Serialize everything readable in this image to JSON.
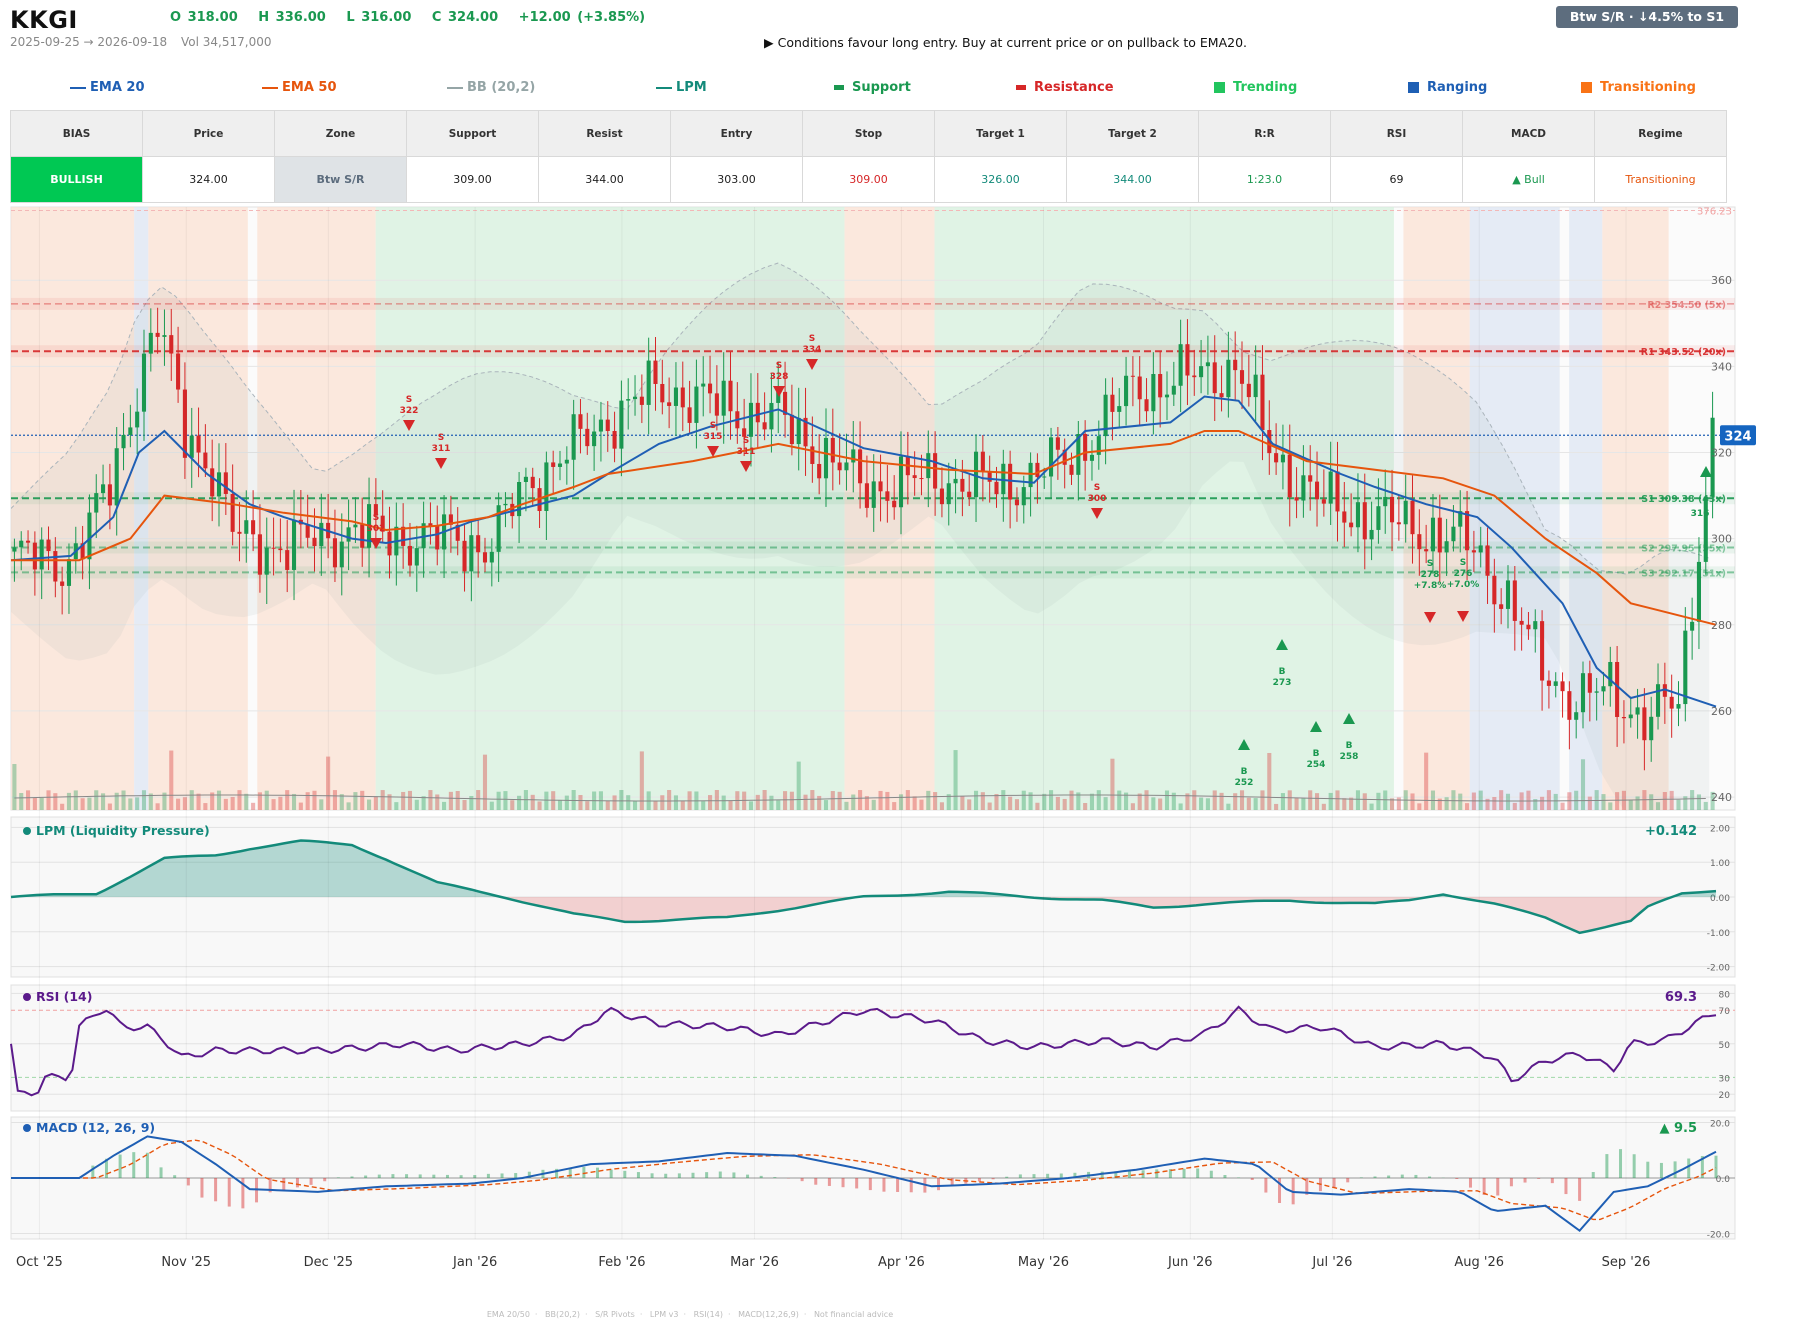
{
  "header": {
    "ticker": "KKGI",
    "ohlc": {
      "open": "O 318.00",
      "high": "H 336.00",
      "low": "L 316.00",
      "close": "C 324.00",
      "change": "+12.00 (+3.85%)"
    },
    "date_range": "2025-09-25 → 2026-09-18",
    "volume": "Vol 34,517,000",
    "advice": "▶  Conditions favour long entry. Buy at current price or on pullback to EMA20.",
    "zone_badge": "Btw S/R  ·  ↓4.5% to S1"
  },
  "legend": {
    "ema20": "EMA 20",
    "ema50": "EMA 50",
    "bb": "BB (20,2)",
    "lpm": "LPM",
    "support": "Support",
    "resistance": "Resistance",
    "trending": "Trending",
    "ranging": "Ranging",
    "transitioning": "Transitioning"
  },
  "colors": {
    "bull": "#1a9850",
    "bear": "#d62728",
    "ema20": "#1f5fb4",
    "ema50": "#e6550d",
    "bb": "#95a5a6",
    "lpm": "#138a7a",
    "support": "#1a9850",
    "resistance": "#d62728",
    "rsi": "#5b1a8b",
    "macd": "#1f5fb4",
    "trending": "#22c55e",
    "ranging": "#1e5fb4",
    "transitioning": "#f97316",
    "bullish_badge": "#00c853"
  },
  "summary": {
    "headers": [
      "BIAS",
      "Price",
      "Zone",
      "Support",
      "Resist",
      "Entry",
      "Stop",
      "Target 1",
      "Target 2",
      "R:R",
      "RSI",
      "MACD",
      "Regime"
    ],
    "values": [
      "BULLISH",
      "324.00",
      "Btw S/R",
      "309.00",
      "344.00",
      "303.00",
      "309.00",
      "326.00",
      "344.00",
      "1:23.0",
      "69",
      "▲ Bull",
      "Transitioning"
    ]
  },
  "price_axis": {
    "ticks": [
      "240",
      "260",
      "280",
      "300",
      "320",
      "340",
      "360"
    ],
    "top_label": "376.23",
    "last_price": "324"
  },
  "levels": {
    "r2": "R2 354.50 (5x)",
    "r1": "R1 343.52 (20x)",
    "s1": "S1 309.38 (43x)",
    "s2": "S2 297.95 (55x)",
    "s3": "S3 292.17 (51x)",
    "last_s_label": "316"
  },
  "months": [
    "Oct '25",
    "Nov '25",
    "Dec '25",
    "Jan '26",
    "Feb '26",
    "Mar '26",
    "Apr '26",
    "May '26",
    "Jun '26",
    "Jul '26",
    "Aug '26",
    "Sep '26"
  ],
  "signals": {
    "sell": [
      {
        "label": "S",
        "value": "302"
      },
      {
        "label": "S",
        "value": "322"
      },
      {
        "label": "S",
        "value": "311"
      },
      {
        "label": "S",
        "value": "315"
      },
      {
        "label": "S",
        "value": "311"
      },
      {
        "label": "S",
        "value": "328"
      },
      {
        "label": "S",
        "value": "334"
      },
      {
        "label": "S",
        "value": "300"
      },
      {
        "label": "S",
        "value": "278",
        "pct": "+7.8%"
      },
      {
        "label": "S",
        "value": "276",
        "pct": "+7.0%"
      }
    ],
    "buy": [
      {
        "label": "B",
        "value": "252"
      },
      {
        "label": "B",
        "value": "273"
      },
      {
        "label": "B",
        "value": "254"
      },
      {
        "label": "B",
        "value": "258"
      }
    ]
  },
  "panels": {
    "lpm": {
      "title": "LPM (Liquidity Pressure)",
      "value": "+0.142",
      "ticks": [
        "2.00",
        "1.00",
        "0.00",
        "-1.00",
        "-2.00"
      ]
    },
    "rsi": {
      "title": "RSI (14)",
      "value": "69.3",
      "ticks": [
        "80",
        "70",
        "50",
        "30",
        "20"
      ]
    },
    "macd": {
      "title": "MACD (12, 26, 9)",
      "value": "▲ 9.5",
      "ticks": [
        "20.0",
        "0.0",
        "-20.0"
      ]
    }
  },
  "footer": [
    "EMA 20/50",
    "BB(20,2)",
    "S/R Pivots",
    "LPM v3",
    "RSI(14)",
    "MACD(12,26,9)",
    "Not financial advice"
  ],
  "chart_data": {
    "type": "candlestick",
    "ylim": [
      237,
      377
    ],
    "regimes": [
      {
        "type": "transitioning",
        "start": "2025-09-25",
        "end": "2025-10-21"
      },
      {
        "type": "ranging",
        "start": "2025-10-21",
        "end": "2025-10-24"
      },
      {
        "type": "transitioning",
        "start": "2025-10-24",
        "end": "2025-11-14"
      },
      {
        "type": "transitioning",
        "start": "2025-11-16",
        "end": "2025-12-11"
      },
      {
        "type": "trending",
        "start": "2025-12-11",
        "end": "2026-03-20"
      },
      {
        "type": "transitioning",
        "start": "2026-03-20",
        "end": "2026-04-08"
      },
      {
        "type": "trending",
        "start": "2026-04-08",
        "end": "2026-07-14"
      },
      {
        "type": "transitioning",
        "start": "2026-07-16",
        "end": "2026-07-30"
      },
      {
        "type": "ranging",
        "start": "2026-07-30",
        "end": "2026-08-18"
      },
      {
        "type": "ranging",
        "start": "2026-08-20",
        "end": "2026-08-27"
      },
      {
        "type": "transitioning",
        "start": "2026-08-27",
        "end": "2026-09-10"
      }
    ],
    "levels": [
      {
        "name": "R2",
        "value": 354.5,
        "touches": 5,
        "kind": "resistance"
      },
      {
        "name": "R1",
        "value": 343.52,
        "touches": 20,
        "kind": "resistance"
      },
      {
        "name": "S1",
        "value": 309.38,
        "touches": 43,
        "kind": "support"
      },
      {
        "name": "S2",
        "value": 297.95,
        "touches": 55,
        "kind": "support"
      },
      {
        "name": "S3",
        "value": 292.17,
        "touches": 51,
        "kind": "support"
      }
    ],
    "last_close": 324,
    "series": [
      {
        "name": "EMA 20",
        "points": [
          [
            0,
            295
          ],
          [
            0.035,
            296
          ],
          [
            0.06,
            305
          ],
          [
            0.075,
            320
          ],
          [
            0.09,
            325
          ],
          [
            0.115,
            315
          ],
          [
            0.14,
            308
          ],
          [
            0.16,
            305
          ],
          [
            0.2,
            300
          ],
          [
            0.22,
            299
          ],
          [
            0.25,
            301
          ],
          [
            0.27,
            304
          ],
          [
            0.3,
            307
          ],
          [
            0.33,
            310
          ],
          [
            0.35,
            315
          ],
          [
            0.38,
            322
          ],
          [
            0.41,
            326
          ],
          [
            0.45,
            330
          ],
          [
            0.5,
            321
          ],
          [
            0.54,
            318
          ],
          [
            0.57,
            314
          ],
          [
            0.6,
            313
          ],
          [
            0.63,
            325
          ],
          [
            0.68,
            327
          ],
          [
            0.7,
            333
          ],
          [
            0.72,
            332
          ],
          [
            0.74,
            322
          ],
          [
            0.78,
            315
          ],
          [
            0.8,
            312
          ],
          [
            0.83,
            308
          ],
          [
            0.86,
            305
          ],
          [
            0.88,
            298
          ],
          [
            0.91,
            285
          ],
          [
            0.93,
            270
          ],
          [
            0.95,
            263
          ],
          [
            0.97,
            265
          ],
          [
            1.0,
            261
          ]
        ]
      },
      {
        "name": "EMA 50",
        "points": [
          [
            0,
            295
          ],
          [
            0.04,
            295
          ],
          [
            0.07,
            300
          ],
          [
            0.09,
            310
          ],
          [
            0.13,
            308
          ],
          [
            0.16,
            306
          ],
          [
            0.2,
            304
          ],
          [
            0.22,
            302
          ],
          [
            0.25,
            303
          ],
          [
            0.28,
            305
          ],
          [
            0.3,
            308
          ],
          [
            0.33,
            312
          ],
          [
            0.35,
            315
          ],
          [
            0.4,
            318
          ],
          [
            0.45,
            322
          ],
          [
            0.5,
            318
          ],
          [
            0.55,
            316
          ],
          [
            0.6,
            315
          ],
          [
            0.63,
            320
          ],
          [
            0.68,
            322
          ],
          [
            0.7,
            325
          ],
          [
            0.72,
            325
          ],
          [
            0.76,
            318
          ],
          [
            0.8,
            316
          ],
          [
            0.84,
            314
          ],
          [
            0.87,
            310
          ],
          [
            0.9,
            300
          ],
          [
            0.93,
            292
          ],
          [
            0.95,
            285
          ],
          [
            0.98,
            282
          ],
          [
            1.0,
            280
          ]
        ]
      }
    ]
  }
}
